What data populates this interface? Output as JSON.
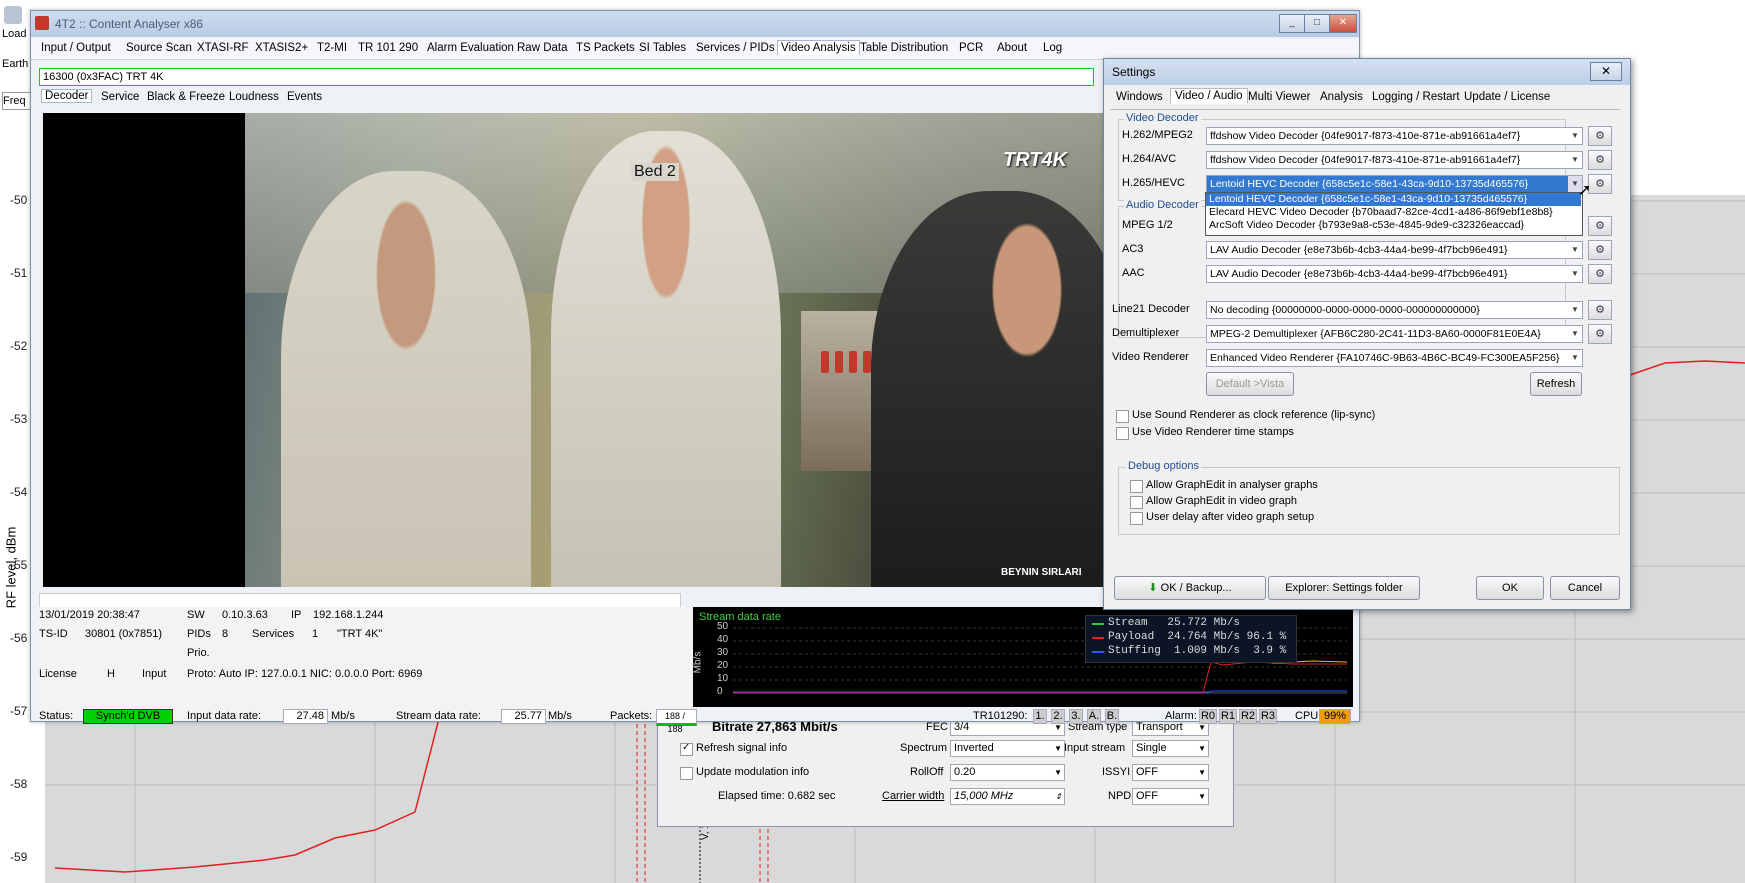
{
  "background": {
    "toolbar_label": "Load",
    "left_items": [
      "Earth",
      "Freq"
    ],
    "y_ticks": [
      "-50",
      "-51",
      "-52",
      "-53",
      "-54",
      "-55",
      "-56",
      "-57",
      "-58",
      "-59"
    ],
    "y_label": "RF level, dBm",
    "vertical_label": "V, 12500"
  },
  "main_window": {
    "title": "4T2 :: Content Analyser x86",
    "menu": [
      "Input / Output",
      "Source Scan",
      "XTASI-RF",
      "XTASIS2+",
      "T2-MI",
      "TR 101 290",
      "Alarm Evaluation",
      "Raw Data",
      "TS Packets",
      "SI Tables",
      "Services / PIDs",
      "Video Analysis",
      "Table Distribution",
      "PCR",
      "About",
      "Log"
    ],
    "active_menu": "Video Analysis",
    "service": "16300 (0x3FAC) TRT 4K",
    "sub_tabs": [
      "Decoder",
      "Service",
      "Black & Freeze",
      "Loudness",
      "Events"
    ],
    "video": {
      "logo": "TRT4K",
      "caption": "BEYNIN SIRLARI",
      "sign": "Bed 2"
    },
    "info": {
      "datetime": "13/01/2019 20:38:47",
      "sw_label": "SW",
      "sw": "0.10.3.63",
      "ip_label": "IP",
      "ip": "192.168.1.244",
      "tsid_label": "TS-ID",
      "tsid": "30801 (0x7851)",
      "pids_label": "PIDs",
      "pids": "8",
      "services_label": "Services",
      "services": "1",
      "service_name": "\"TRT 4K\"",
      "prio_label": "Prio.",
      "license_label": "License",
      "license": "H",
      "input_label": "Input",
      "input": "Proto: Auto IP: 127.0.0.1 NIC: 0.0.0.0 Port: 6969"
    },
    "status": {
      "status_label": "Status:",
      "status": "Synch'd DVB",
      "input_rate_label": "Input data rate:",
      "input_rate": "27.48",
      "input_rate_unit": "Mb/s",
      "stream_rate_label": "Stream data rate:",
      "stream_rate": "25.77",
      "stream_rate_unit": "Mb/s",
      "packets_label": "Packets:",
      "packets": "188 / 188",
      "tr_label": "TR101290:",
      "tr_items": [
        "1.",
        "2.",
        "3.",
        "A.",
        "B."
      ],
      "alarm_label": "Alarm:",
      "alarm_items": [
        "R0",
        "R1",
        "R2",
        "R3"
      ],
      "cpu_label": "CPU",
      "cpu": "99%"
    },
    "graph": {
      "title": "Stream data rate",
      "y_axis_label": "Mb/s",
      "y_ticks": [
        "50",
        "40",
        "30",
        "20",
        "10",
        "0"
      ],
      "legend": [
        {
          "name": "Stream",
          "value": "25.772 Mb/s",
          "pct": "",
          "color": "#2ecc40"
        },
        {
          "name": "Payload",
          "value": "24.764 Mb/s",
          "pct": "96.1 %",
          "color": "#e02020"
        },
        {
          "name": "Stuffing",
          "value": "1.009 Mb/s",
          "pct": "3.9 %",
          "color": "#3355ff"
        }
      ]
    }
  },
  "settings": {
    "title": "Settings",
    "tabs": [
      "Windows",
      "Video / Audio",
      "Multi Viewer",
      "Analysis",
      "Logging / Restart",
      "Update / License"
    ],
    "active_tab": "Video / Audio",
    "video_group": "Video Decoder",
    "audio_group": "Audio Decoder",
    "rows": [
      {
        "label": "H.262/MPEG2",
        "value": "ffdshow Video Decoder {04fe9017-f873-410e-871e-ab91661a4ef7}"
      },
      {
        "label": "H.264/AVC",
        "value": "ffdshow Video Decoder {04fe9017-f873-410e-871e-ab91661a4ef7}"
      },
      {
        "label": "H.265/HEVC",
        "value": "Lentoid HEVC Decoder {658c5e1c-58e1-43ca-9d10-13735d465576}"
      },
      {
        "label": "MPEG 1/2",
        "value": ""
      },
      {
        "label": "AC3",
        "value": "LAV Audio Decoder {e8e73b6b-4cb3-44a4-be99-4f7bcb96e491}"
      },
      {
        "label": "AAC",
        "value": "LAV Audio Decoder {e8e73b6b-4cb3-44a4-be99-4f7bcb96e491}"
      },
      {
        "label": "Line21 Decoder",
        "value": "No decoding {00000000-0000-0000-0000-000000000000}"
      },
      {
        "label": "Demultiplexer",
        "value": "MPEG-2 Demultiplexer {AFB6C280-2C41-11D3-8A60-0000F81E0E4A}"
      },
      {
        "label": "Video Renderer",
        "value": "Enhanced Video Renderer {FA10746C-9B63-4B6C-BC49-FC300EA5F256}"
      }
    ],
    "dropdown_options": [
      "Lentoid HEVC Decoder {658c5e1c-58e1-43ca-9d10-13735d465576}",
      "Elecard HEVC Video Decoder {b70baad7-82ce-4cd1-a486-86f9ebf1e8b8}",
      "ArcSoft Video Decoder {b793e9a8-c53e-4845-9de9-c32326eaccad}"
    ],
    "default_button": "Default >Vista",
    "refresh_button": "Refresh",
    "checkboxes": [
      "Use Sound Renderer as clock reference (lip-sync)",
      "Use Video Renderer time stamps"
    ],
    "debug_group": "Debug options",
    "debug_checkboxes": [
      "Allow GraphEdit in analyser graphs",
      "Allow GraphEdit in video graph",
      "User delay after video graph setup"
    ],
    "ok_backup": "OK / Backup...",
    "explorer": "Explorer: Settings folder",
    "ok": "OK",
    "cancel": "Cancel"
  },
  "lower_dialog": {
    "bitrate": "Bitrate 27,863 Mbit/s",
    "fec_label": "FEC",
    "fec": "3/4",
    "stream_type_label": "Stream type",
    "stream_type": "Transport",
    "refresh_signal": "Refresh signal info",
    "spectrum_label": "Spectrum",
    "spectrum": "Inverted",
    "input_stream_label": "Input stream",
    "input_stream": "Single",
    "update_mod": "Update modulation info",
    "rolloff_label": "RollOff",
    "rolloff": "0.20",
    "issyi_label": "ISSYI",
    "issyi": "OFF",
    "elapsed": "Elapsed time: 0.682 sec",
    "carrier_label": "Carrier width",
    "carrier": "15,000 MHz",
    "npd_label": "NPD",
    "npd": "OFF"
  }
}
